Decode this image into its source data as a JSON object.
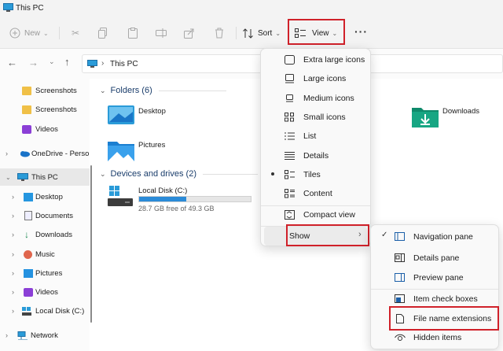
{
  "window": {
    "title": "This PC"
  },
  "toolbar": {
    "new_label": "New",
    "sort_label": "Sort",
    "view_label": "View",
    "more_label": "···"
  },
  "address": {
    "path": "This PC"
  },
  "sidebar": {
    "items": [
      {
        "label": "Screenshots"
      },
      {
        "label": "Screenshots"
      },
      {
        "label": "Videos"
      },
      {
        "label": "OneDrive - Perso"
      },
      {
        "label": "This PC"
      },
      {
        "label": "Desktop"
      },
      {
        "label": "Documents"
      },
      {
        "label": "Downloads"
      },
      {
        "label": "Music"
      },
      {
        "label": "Pictures"
      },
      {
        "label": "Videos"
      },
      {
        "label": "Local Disk (C:)"
      },
      {
        "label": "Network"
      }
    ]
  },
  "content": {
    "folders_header": "Folders (6)",
    "folders": [
      {
        "label": "Desktop"
      },
      {
        "label": "Downloads"
      },
      {
        "label": "Pictures"
      }
    ],
    "drives_header": "Devices and drives (2)",
    "drive": {
      "name": "Local Disk (C:)",
      "free_text": "28.7 GB free of 49.3 GB",
      "used_fraction": 0.42
    }
  },
  "view_menu": {
    "items": [
      {
        "label": "Extra large icons"
      },
      {
        "label": "Large icons"
      },
      {
        "label": "Medium icons"
      },
      {
        "label": "Small icons"
      },
      {
        "label": "List"
      },
      {
        "label": "Details"
      },
      {
        "label": "Tiles",
        "selected": true
      },
      {
        "label": "Content"
      },
      {
        "label": "Compact view"
      },
      {
        "label": "Show"
      }
    ]
  },
  "show_menu": {
    "items": [
      {
        "label": "Navigation pane",
        "checked": true
      },
      {
        "label": "Details pane"
      },
      {
        "label": "Preview pane"
      },
      {
        "label": "Item check boxes"
      },
      {
        "label": "File name extensions"
      },
      {
        "label": "Hidden items"
      }
    ]
  },
  "colors": {
    "highlight": "#d0212a",
    "accent": "#0067c0",
    "drive_bar": "#2b8bd8"
  }
}
